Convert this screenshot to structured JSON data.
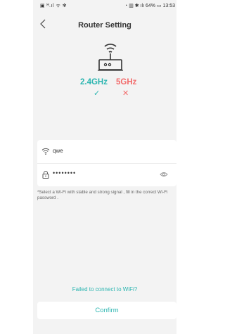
{
  "status_bar": {
    "left": "▣ ᴴ.ıl ᯤ ✻",
    "right": "◔ ▥ ✱ ılı 64% ▭ 13:53"
  },
  "header": {
    "title": "Router Setting"
  },
  "bands": {
    "band_24": "2.4GHz",
    "band_5": "5GHz",
    "status_24": "✓",
    "status_5": "✕",
    "color_ok": "#2bb5b0",
    "color_fail": "#f26b6b"
  },
  "form": {
    "ssid": "qwe",
    "password_masked": "••••••••",
    "hint": "*Select a Wi-Fi with stable and strong signal , fill in the correct Wi-Fi password ."
  },
  "footer": {
    "failed_link": "Failed to connect to WiFi?",
    "confirm_label": "Confirm"
  },
  "icons": [
    "back-chevron-icon",
    "router-icon",
    "wifi-icon",
    "lock-icon",
    "eye-icon"
  ]
}
